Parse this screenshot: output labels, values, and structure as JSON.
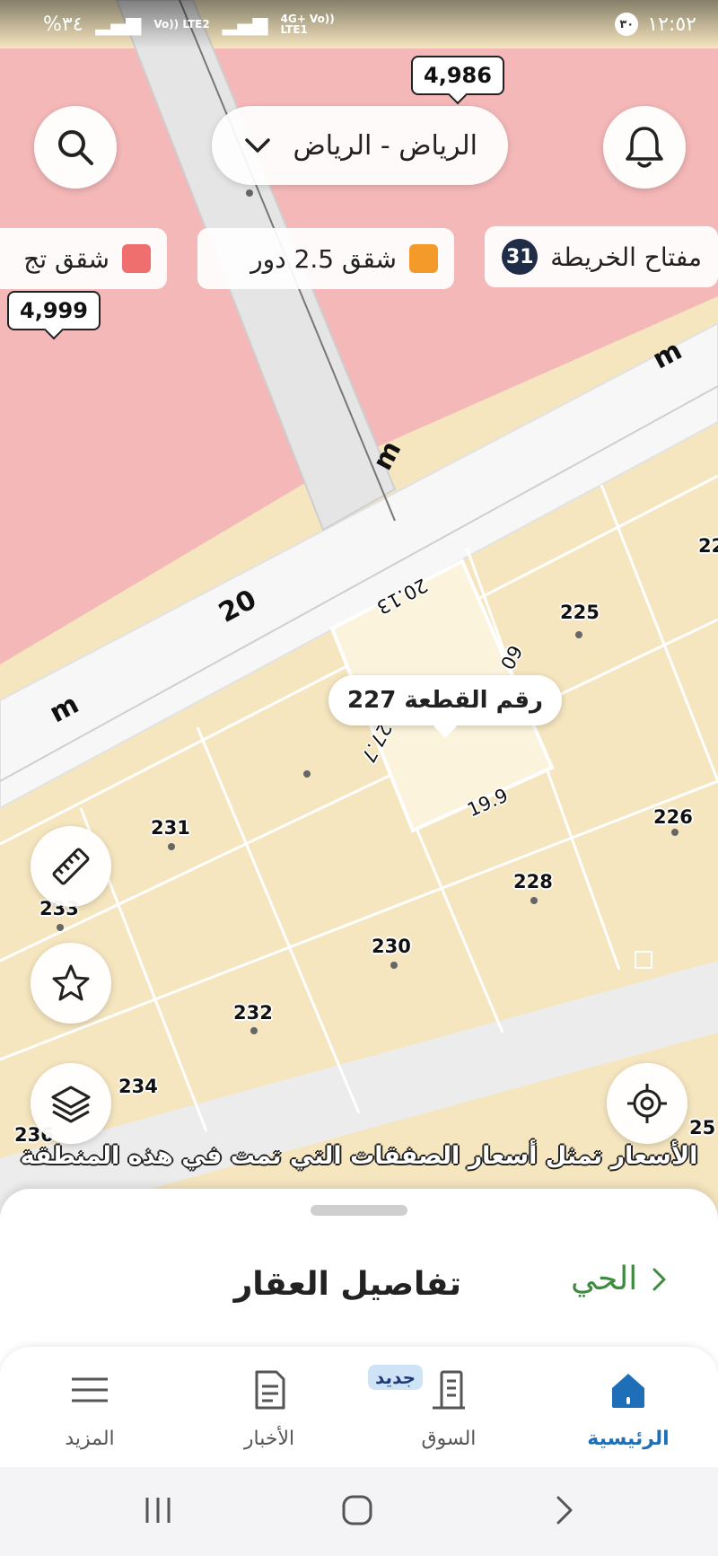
{
  "status_bar": {
    "time": "١٢:٥٢",
    "notification_count": "٣٠",
    "battery": "%٣٤",
    "network_left": "Vo)) LTE2",
    "network_right_top": "4G+ Vo))",
    "network_right_bottom": "LTE1"
  },
  "top": {
    "city_select_label": "الرياض - الرياض",
    "search_icon": "search-icon",
    "bell_icon": "bell-icon"
  },
  "price_markers": [
    {
      "label": "4,986"
    },
    {
      "label": "4,999"
    }
  ],
  "legend_chips": {
    "map_key_label": "مفتاح الخريطة",
    "map_key_count": "31",
    "chip_orange_label": "شقق 2.5 دور",
    "chip_red_label": "شقق تج",
    "orange_color": "#f39a2b",
    "red_color": "#ef6f6f"
  },
  "map": {
    "street_width_label": "20",
    "street_unit_labels": [
      "m",
      "m",
      "m"
    ],
    "dimension_labels": {
      "top": "20.13",
      "side": "27.7",
      "side_right": "60",
      "bottom": "19.9"
    },
    "plots": [
      "225",
      "226",
      "227",
      "228",
      "230",
      "231",
      "232",
      "233",
      "234",
      "236",
      "22",
      "25"
    ],
    "residential_color": "#f5e6bf",
    "commercial_color": "#f4b8b8"
  },
  "plot_tooltip": {
    "label": "رقم القطعة 227"
  },
  "price_note": "الأسعار تمثل أسعار الصفقات التي تمت في هذه المنطقة",
  "sheet": {
    "title": "تفاصيل العقار",
    "neighborhood_link": "الحي"
  },
  "tabs": [
    {
      "label": "الرئيسية",
      "active": true
    },
    {
      "label": "السوق",
      "badge": "جديد"
    },
    {
      "label": "الأخبار"
    },
    {
      "label": "المزيد"
    }
  ],
  "accent_color": "#1f6fb8"
}
